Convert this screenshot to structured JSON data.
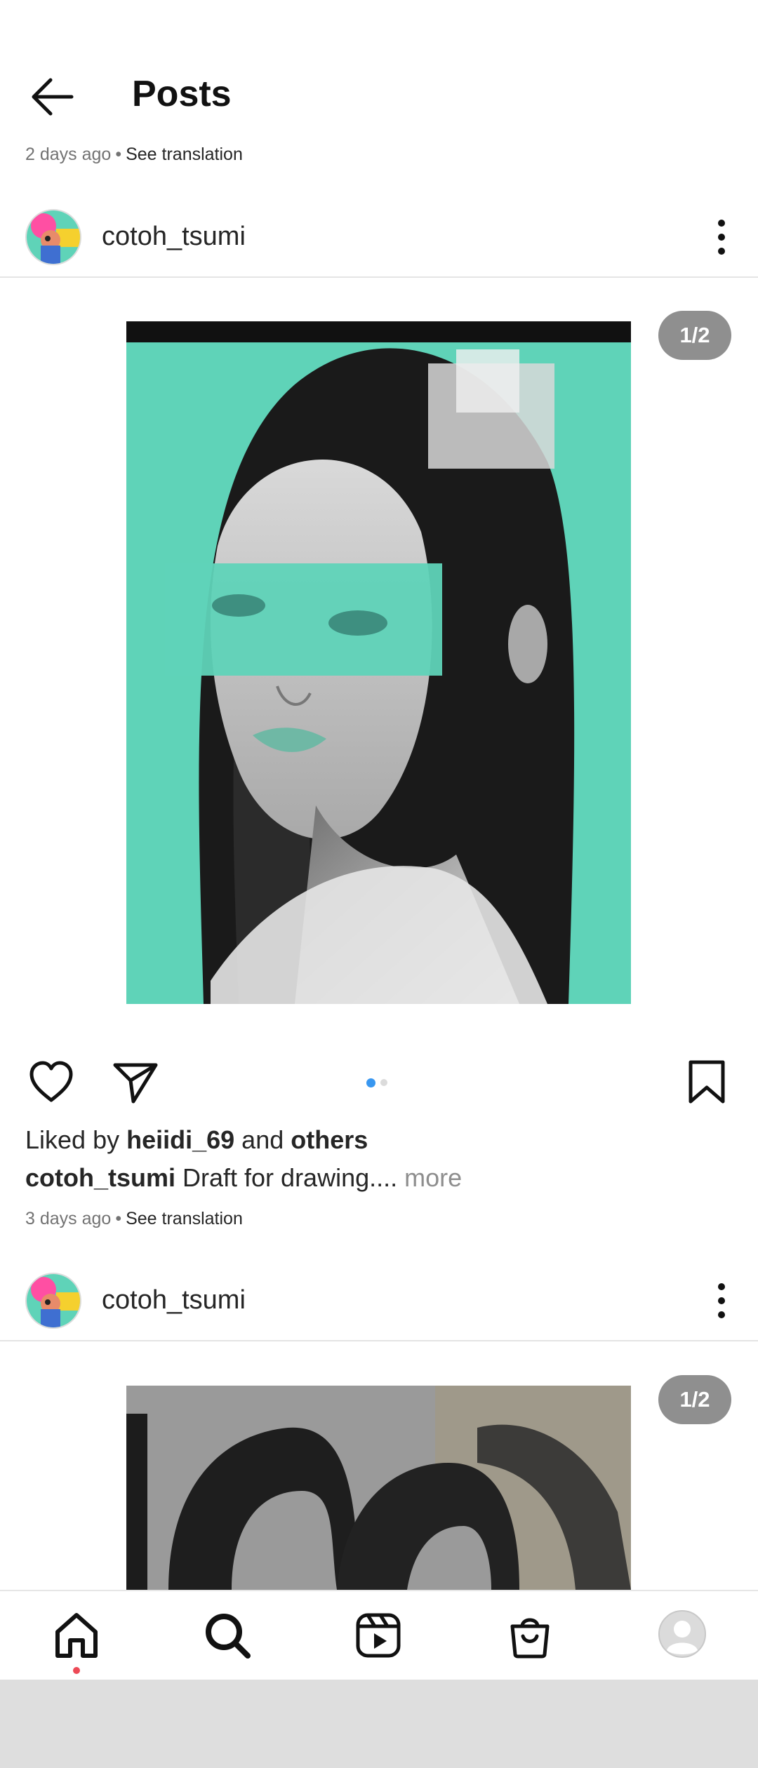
{
  "header": {
    "title": "Posts",
    "back_icon": "arrow-left-icon"
  },
  "top_meta": {
    "time": "2 days ago",
    "separator": "•",
    "translate": "See translation"
  },
  "post1": {
    "username": "cotoh_tsumi",
    "counter": "1/2",
    "liked_prefix": "Liked by ",
    "liked_user": "heiidi_69",
    "liked_mid": " and ",
    "liked_others": "others",
    "caption_user": "cotoh_tsumi",
    "caption_text": " Draft for drawing....",
    "caption_more": " more",
    "time": "3 days ago",
    "separator": "•",
    "translate": "See translation",
    "carousel": {
      "count": 2,
      "active": 1
    }
  },
  "post2": {
    "username": "cotoh_tsumi",
    "counter": "1/2"
  },
  "colors": {
    "teal": "#5fd3b8",
    "active_dot": "#3897f0",
    "inactive_dot": "#dbdbdb",
    "notification_dot": "#ed4956"
  },
  "bottom_nav": {
    "items": [
      "home-icon",
      "search-icon",
      "reels-icon",
      "shop-icon",
      "profile-avatar"
    ]
  }
}
